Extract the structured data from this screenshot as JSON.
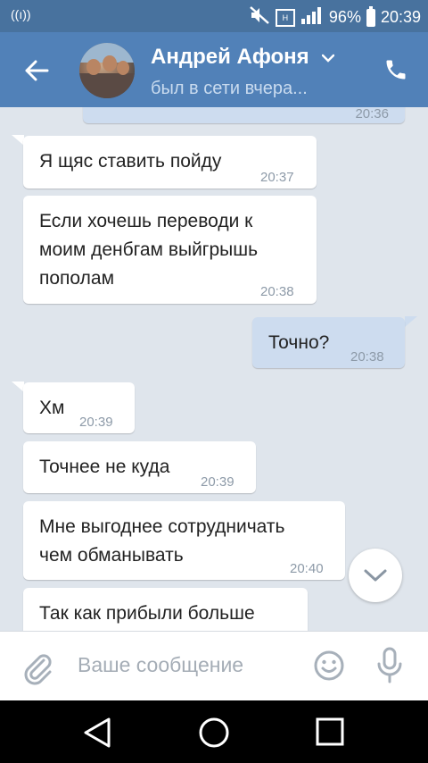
{
  "status_bar": {
    "left_indicator": "((ı))",
    "battery_percent": "96%",
    "time": "20:39",
    "hd_label": "H"
  },
  "header": {
    "contact_name": "Андрей Афоня",
    "status": "был в сети вчера...",
    "icons": {
      "back": "arrow-left-icon",
      "call": "phone-icon",
      "dropdown": "chevron-down-icon"
    }
  },
  "messages": [
    {
      "id": 0,
      "direction": "out",
      "text": "",
      "time": "20:36"
    },
    {
      "id": 1,
      "direction": "in",
      "text": "Я щяс ставить пойду",
      "time": "20:37"
    },
    {
      "id": 2,
      "direction": "in",
      "lines": [
        "Если хочешь переводи к",
        "моим денбгам выйгрышь",
        "пополам"
      ],
      "time": "20:38"
    },
    {
      "id": 3,
      "direction": "out",
      "text": "Точно?",
      "time": "20:38"
    },
    {
      "id": 4,
      "direction": "in",
      "text": "Хм",
      "time": "20:39"
    },
    {
      "id": 5,
      "direction": "in",
      "text": "Точнее не куда",
      "time": "20:39"
    },
    {
      "id": 6,
      "direction": "in",
      "lines": [
        "Мне выгоднее сотрудничать",
        "чем обманывать"
      ],
      "time": "20:40"
    },
    {
      "id": 7,
      "direction": "in",
      "text": "Так как прибыли больше",
      "time": ""
    }
  ],
  "composer": {
    "placeholder": "Ваше сообщение",
    "icons": {
      "attach": "paperclip-icon",
      "emoji": "smiley-icon",
      "mic": "microphone-icon"
    }
  },
  "navigation": {
    "icons": {
      "back": "nav-back-icon",
      "home": "nav-home-icon",
      "recents": "nav-recents-icon"
    }
  },
  "colors": {
    "status_bar": "#48729e",
    "app_bar": "#5181b8",
    "chat_background": "#dfe5ec",
    "incoming_bubble": "#ffffff",
    "outgoing_bubble": "#cddcef"
  }
}
